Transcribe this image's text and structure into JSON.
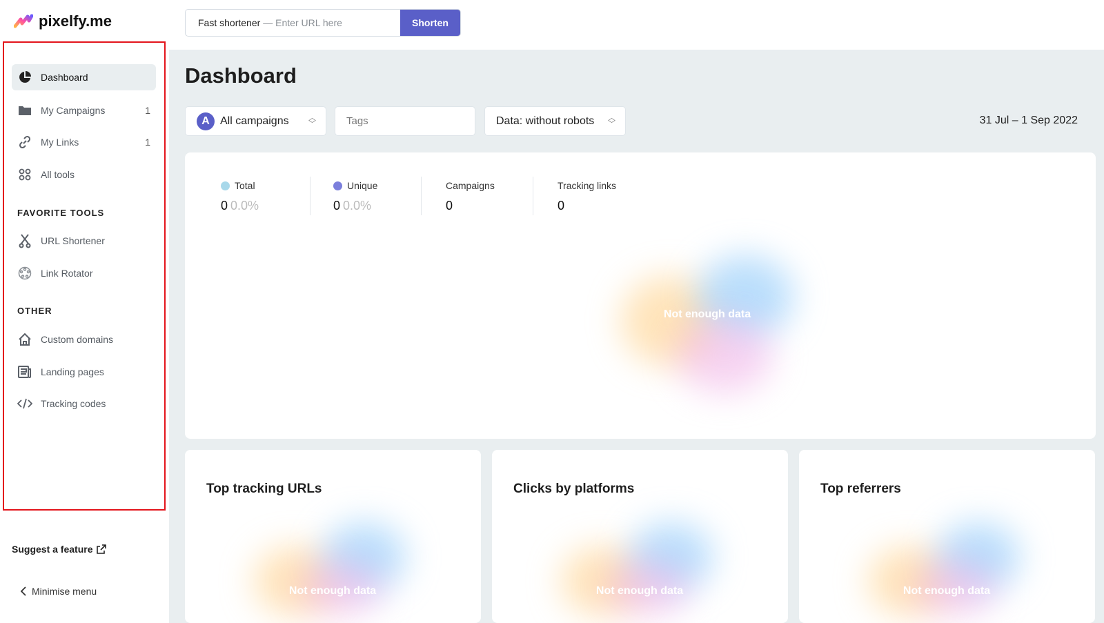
{
  "brand": {
    "name": "pixelfy.me"
  },
  "shortener": {
    "prefix": "Fast shortener",
    "placeholder": "— Enter URL here",
    "button": "Shorten"
  },
  "sidebar": {
    "items": [
      {
        "label": "Dashboard",
        "icon": "pie-chart-icon",
        "active": true
      },
      {
        "label": "My Campaigns",
        "icon": "folder-icon",
        "count": "1"
      },
      {
        "label": "My Links",
        "icon": "link-icon",
        "count": "1"
      },
      {
        "label": "All tools",
        "icon": "grid-icon"
      }
    ],
    "favorites_heading": "FAVORITE TOOLS",
    "favorites": [
      {
        "label": "URL Shortener",
        "icon": "scissors-icon"
      },
      {
        "label": "Link Rotator",
        "icon": "rotator-icon"
      }
    ],
    "other_heading": "OTHER",
    "other": [
      {
        "label": "Custom domains",
        "icon": "home-icon"
      },
      {
        "label": "Landing pages",
        "icon": "newspaper-icon"
      },
      {
        "label": "Tracking codes",
        "icon": "code-icon"
      }
    ],
    "suggest": "Suggest a feature",
    "minimise": "Minimise menu"
  },
  "header": {
    "title": "Dashboard"
  },
  "filters": {
    "campaign_avatar": "A",
    "campaign": "All campaigns",
    "tags_placeholder": "Tags",
    "data": "Data: without robots",
    "date_range": "31 Jul – 1 Sep 2022"
  },
  "stats": [
    {
      "label": "Total",
      "value": "0",
      "pct": "0.0%",
      "color": "#a8d8ea"
    },
    {
      "label": "Unique",
      "value": "0",
      "pct": "0.0%",
      "color": "#7b7fdc"
    },
    {
      "label": "Campaigns",
      "value": "0"
    },
    {
      "label": "Tracking links",
      "value": "0"
    }
  ],
  "empty_text": "Not enough data",
  "cards": [
    {
      "title": "Top tracking URLs",
      "empty": "Not enough data"
    },
    {
      "title": "Clicks by platforms",
      "empty": "Not enough data"
    },
    {
      "title": "Top referrers",
      "empty": "Not enough data"
    }
  ]
}
